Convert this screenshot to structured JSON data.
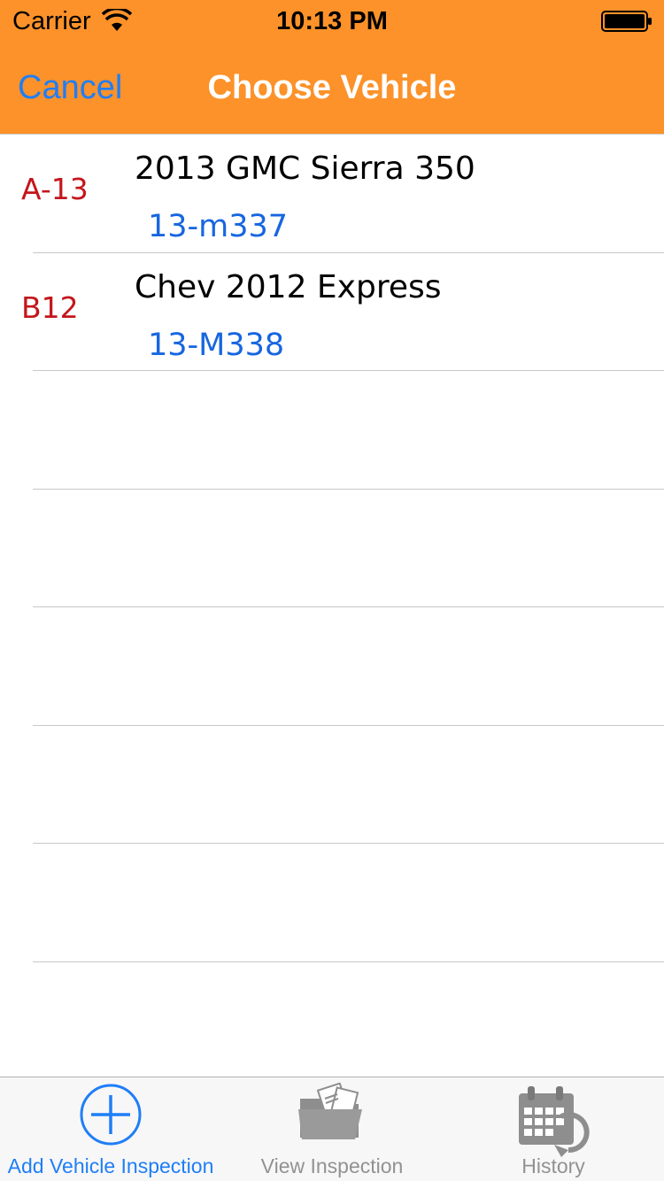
{
  "status_bar": {
    "carrier": "Carrier",
    "time": "10:13 PM",
    "wifi_icon": "wifi-icon",
    "battery_icon": "battery-full-icon"
  },
  "nav": {
    "cancel_label": "Cancel",
    "title": "Choose Vehicle"
  },
  "vehicles": [
    {
      "code": "A-13",
      "name": "2013 GMC Sierra 350",
      "plate": "13-m337"
    },
    {
      "code": "B12",
      "name": "Chev 2012 Express",
      "plate": "13-M338"
    }
  ],
  "tabs": [
    {
      "label": "Add Vehicle Inspection",
      "icon": "add-circle-icon",
      "active": true
    },
    {
      "label": "View Inspection",
      "icon": "folder-icon",
      "active": false
    },
    {
      "label": "History",
      "icon": "calendar-history-icon",
      "active": false
    }
  ],
  "colors": {
    "header_bg": "#fc9229",
    "accent_blue": "#1f7ef7",
    "code_red": "#c4161c",
    "plate_blue": "#1766e0",
    "inactive_gray": "#929292"
  }
}
